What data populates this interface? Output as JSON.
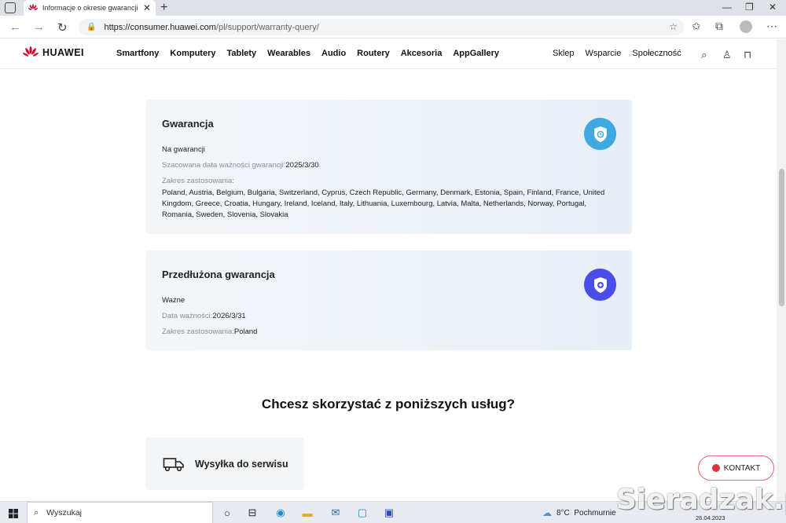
{
  "browser": {
    "tab_title": "Informacje o okresie gwarancji | ",
    "tab_close": "✕",
    "new_tab": "+",
    "url_host": "https://consumer.huawei.com",
    "url_path": "/pl/support/warranty-query/"
  },
  "header": {
    "brand": "HUAWEI",
    "nav": [
      "Smartfony",
      "Komputery",
      "Tablety",
      "Wearables",
      "Audio",
      "Routery",
      "Akcesoria",
      "AppGallery"
    ],
    "right_nav": [
      "Sklep",
      "Wsparcie",
      "Społeczność"
    ]
  },
  "warranty": {
    "title": "Gwarancja",
    "status": "Na gwarancji",
    "expiry_label": "Szacowana data ważności gwarancji:",
    "expiry_value": "2025/3/30",
    "scope_label": "Zakres zastosowania:",
    "countries": "Poland, Austria, Belgium, Bulgaria, Switzerland, Cyprus, Czech Republic, Germany, Denmark, Estonia, Spain, Finland, France, United Kingdom, Greece, Croatia, Hungary, Ireland, Iceland, Italy, Lithuania, Luxembourg, Latvia, Malta, Netherlands, Norway, Portugal, Romania, Sweden, Slovenia, Slovakia"
  },
  "extended": {
    "title": "Przedłużona gwarancja",
    "status": "Ważne",
    "expiry_label": "Data ważności:",
    "expiry_value": "2026/3/31",
    "scope_label": "Zakres zastosowania:",
    "scope_value": "Poland"
  },
  "services": {
    "title": "Chcesz skorzystać z poniższych usług?",
    "items": [
      {
        "label": "Wysyłka do serwisu"
      }
    ]
  },
  "contact_button": "KONTAKT",
  "taskbar": {
    "search_placeholder": "Wyszukaj",
    "weather_temp": "8°C",
    "weather_desc": "Pochmurnie",
    "date": "26.04.2023"
  },
  "watermark": "Sieradzak.pl"
}
